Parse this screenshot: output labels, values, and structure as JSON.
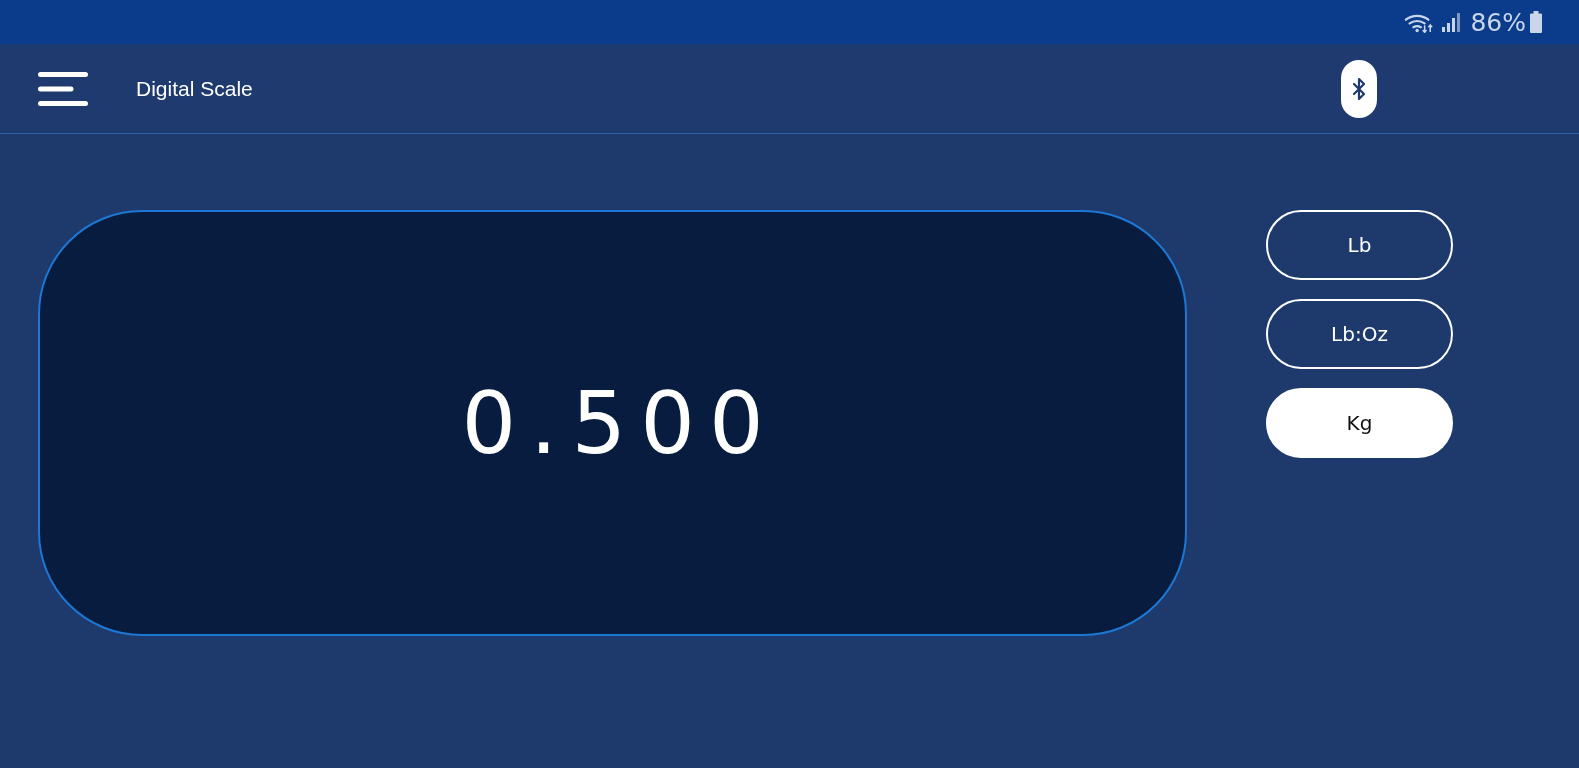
{
  "status_bar": {
    "battery": "86%"
  },
  "app_bar": {
    "title": "Digital Scale"
  },
  "display": {
    "reading": "0.500"
  },
  "units": [
    {
      "label": "Lb",
      "selected": false
    },
    {
      "label": "Lb:Oz",
      "selected": false
    },
    {
      "label": "Kg",
      "selected": true
    }
  ]
}
